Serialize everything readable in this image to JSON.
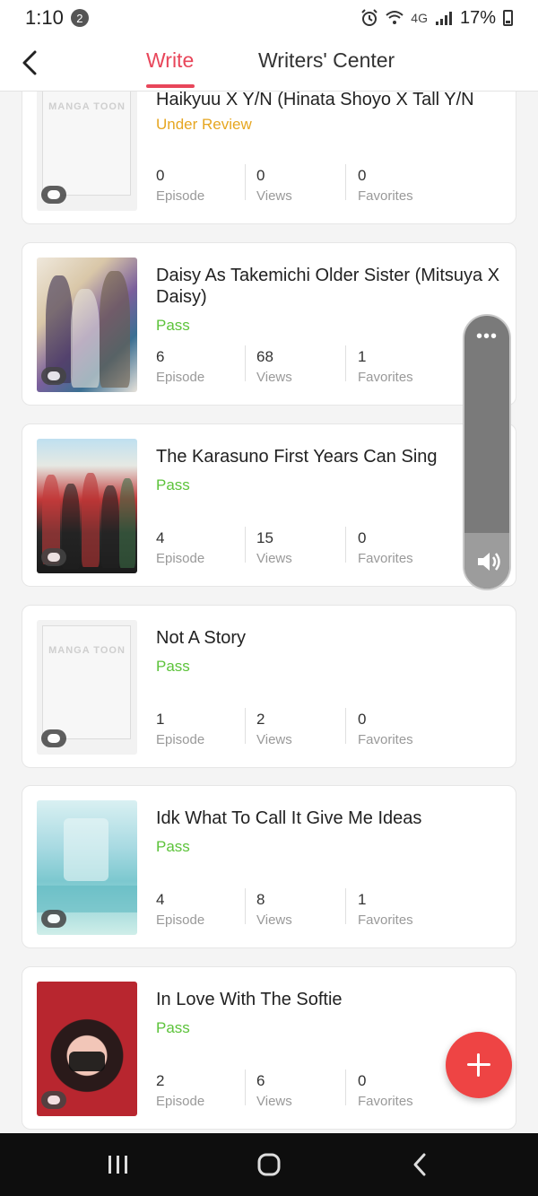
{
  "status_bar": {
    "time": "1:10",
    "notification_count": "2",
    "network": "4G",
    "battery": "17%"
  },
  "header": {
    "tabs": [
      {
        "label": "Write",
        "active": true
      },
      {
        "label": "Writers' Center",
        "active": false
      }
    ]
  },
  "labels": {
    "episode": "Episode",
    "views": "Views",
    "favorites": "Favorites"
  },
  "stories": [
    {
      "title": "Haikyuu X Y/N (Hinata Shoyo X Tall Y/N",
      "status": "Under Review",
      "episodes": "0",
      "views": "0",
      "favorites": "0",
      "cover": "mangatoon-placeholder",
      "logo": "MANGA TOON"
    },
    {
      "title": "Daisy As Takemichi Older Sister (Mitsuya X Daisy)",
      "status": "Pass",
      "episodes": "6",
      "views": "68",
      "favorites": "1",
      "cover": "anime-group-art"
    },
    {
      "title": "The Karasuno First Years Can Sing",
      "status": "Pass",
      "episodes": "4",
      "views": "15",
      "favorites": "0",
      "cover": "volleyball-team-art"
    },
    {
      "title": "Not A Story",
      "status": "Pass",
      "episodes": "1",
      "views": "2",
      "favorites": "0",
      "cover": "mangatoon-placeholder",
      "logo": "MANGA TOON"
    },
    {
      "title": "Idk What To Call It Give Me Ideas",
      "status": "Pass",
      "episodes": "4",
      "views": "8",
      "favorites": "1",
      "cover": "waterfall-art"
    },
    {
      "title": "In Love With The Softie",
      "status": "Pass",
      "episodes": "2",
      "views": "6",
      "favorites": "0",
      "cover": "hooded-girl-art"
    }
  ],
  "colors": {
    "accent": "#e8465a",
    "under_review": "#e6a621",
    "pass": "#5cc33a",
    "fab": "#ee4444"
  },
  "icons": {
    "back": "chevron-left-icon",
    "fab": "plus-icon",
    "float_menu": "more-dots-icon",
    "float_volume": "volume-icon",
    "nav": [
      "recent-apps-icon",
      "home-icon",
      "back-icon"
    ]
  }
}
